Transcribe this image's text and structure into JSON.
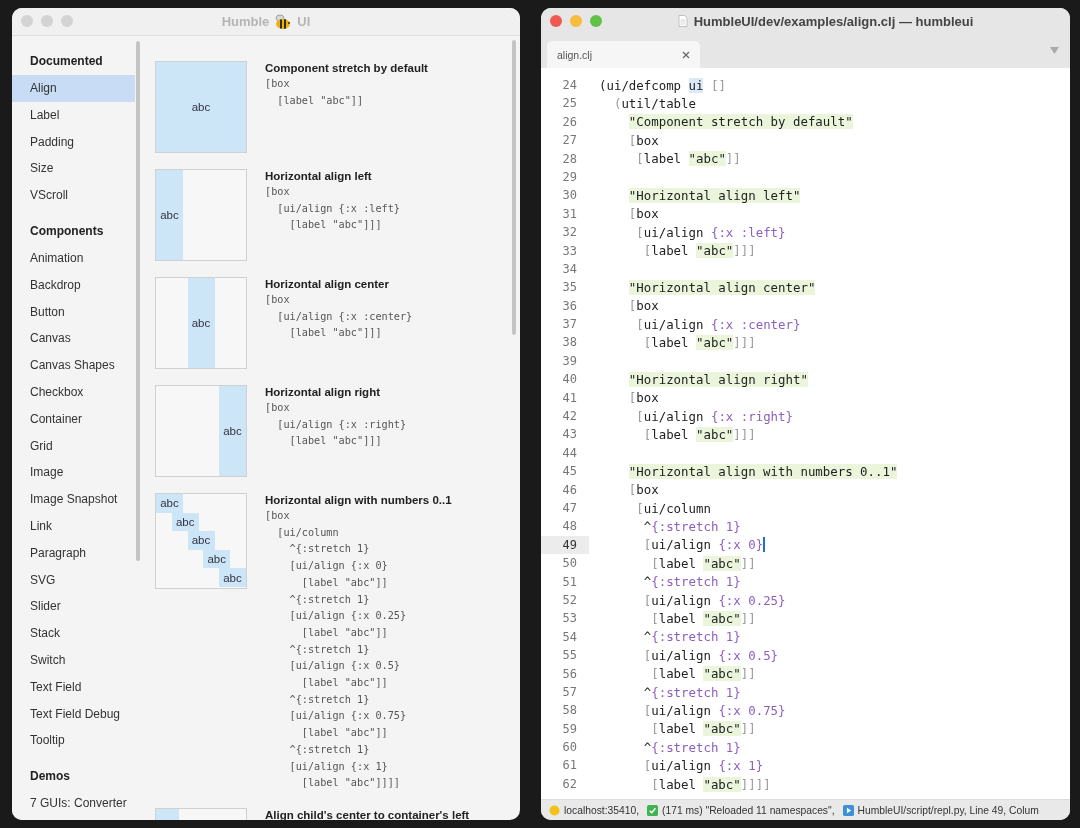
{
  "left_window": {
    "title_before_icon": "Humble",
    "title_after_icon": "UI",
    "sidebar": [
      {
        "heading": "Documented",
        "items": [
          {
            "label": "Align",
            "selected": true
          },
          {
            "label": "Label",
            "selected": false
          },
          {
            "label": "Padding",
            "selected": false
          },
          {
            "label": "Size",
            "selected": false
          },
          {
            "label": "VScroll",
            "selected": false
          }
        ]
      },
      {
        "heading": "Components",
        "items": [
          {
            "label": "Animation",
            "selected": false
          },
          {
            "label": "Backdrop",
            "selected": false
          },
          {
            "label": "Button",
            "selected": false
          },
          {
            "label": "Canvas",
            "selected": false
          },
          {
            "label": "Canvas Shapes",
            "selected": false
          },
          {
            "label": "Checkbox",
            "selected": false
          },
          {
            "label": "Container",
            "selected": false
          },
          {
            "label": "Grid",
            "selected": false
          },
          {
            "label": "Image",
            "selected": false
          },
          {
            "label": "Image Snapshot",
            "selected": false
          },
          {
            "label": "Link",
            "selected": false
          },
          {
            "label": "Paragraph",
            "selected": false
          },
          {
            "label": "SVG",
            "selected": false
          },
          {
            "label": "Slider",
            "selected": false
          },
          {
            "label": "Stack",
            "selected": false
          },
          {
            "label": "Switch",
            "selected": false
          },
          {
            "label": "Text Field",
            "selected": false
          },
          {
            "label": "Text Field Debug",
            "selected": false
          },
          {
            "label": "Tooltip",
            "selected": false
          }
        ]
      },
      {
        "heading": "Demos",
        "items": [
          {
            "label": "7 GUIs: Converter",
            "selected": false
          }
        ]
      }
    ],
    "examples": [
      {
        "title": "Component stretch by default",
        "code": [
          "[box",
          "  [label \"abc\"]]"
        ],
        "preview": {
          "kind": "stretch",
          "labels": [
            "abc"
          ]
        }
      },
      {
        "title": "Horizontal align left",
        "code": [
          "[box",
          "  [ui/align {:x :left}",
          "    [label \"abc\"]]]"
        ],
        "preview": {
          "kind": "left",
          "labels": [
            "abc"
          ]
        }
      },
      {
        "title": "Horizontal align center",
        "code": [
          "[box",
          "  [ui/align {:x :center}",
          "    [label \"abc\"]]]"
        ],
        "preview": {
          "kind": "center",
          "labels": [
            "abc"
          ]
        }
      },
      {
        "title": "Horizontal align right",
        "code": [
          "[box",
          "  [ui/align {:x :right}",
          "    [label \"abc\"]]]"
        ],
        "preview": {
          "kind": "right",
          "labels": [
            "abc"
          ]
        }
      },
      {
        "title": "Horizontal align with numbers 0..1",
        "code": [
          "[box",
          "  [ui/column",
          "    ^{:stretch 1}",
          "    [ui/align {:x 0}",
          "      [label \"abc\"]]",
          "    ^{:stretch 1}",
          "    [ui/align {:x 0.25}",
          "      [label \"abc\"]]",
          "    ^{:stretch 1}",
          "    [ui/align {:x 0.5}",
          "      [label \"abc\"]]",
          "    ^{:stretch 1}",
          "    [ui/align {:x 0.75}",
          "      [label \"abc\"]]",
          "    ^{:stretch 1}",
          "    [ui/align {:x 1}",
          "      [label \"abc\"]]]]"
        ],
        "preview": {
          "kind": "numbers",
          "labels": [
            "abc",
            "abc",
            "abc",
            "abc",
            "abc"
          ]
        }
      },
      {
        "title": "Align child's center to container's left",
        "preview": {
          "kind": "center-left"
        }
      }
    ]
  },
  "editor_window": {
    "title": "HumbleUI/dev/examples/align.clj — humbleui",
    "tabs": [
      {
        "label": "align.clj",
        "selected": true
      }
    ],
    "lines": [
      {
        "num": "24",
        "current": false,
        "segments": [
          {
            "kind": "plain",
            "text": "(ui/defcomp "
          },
          {
            "kind": "highlight",
            "text": "ui"
          },
          {
            "kind": "punct",
            "text": " []"
          }
        ]
      },
      {
        "num": "25",
        "current": false,
        "segments": [
          {
            "kind": "punct",
            "text": "  ("
          },
          {
            "kind": "plain",
            "text": "util/table"
          }
        ]
      },
      {
        "num": "26",
        "current": false,
        "segments": [
          {
            "kind": "string",
            "text": "    \"Component stretch by default\""
          }
        ]
      },
      {
        "num": "27",
        "current": false,
        "segments": [
          {
            "kind": "punct",
            "text": "    ["
          },
          {
            "kind": "plain",
            "text": "box"
          }
        ]
      },
      {
        "num": "28",
        "current": false,
        "segments": [
          {
            "kind": "punct",
            "text": "     ["
          },
          {
            "kind": "plain",
            "text": "label "
          },
          {
            "kind": "string",
            "text": "\"abc\""
          },
          {
            "kind": "punct",
            "text": "]]"
          }
        ]
      },
      {
        "num": "29",
        "current": false
      },
      {
        "num": "30",
        "current": false,
        "segments": [
          {
            "kind": "string",
            "text": "    \"Horizontal align left\""
          }
        ]
      },
      {
        "num": "31",
        "current": false,
        "segments": [
          {
            "kind": "punct",
            "text": "    ["
          },
          {
            "kind": "plain",
            "text": "box"
          }
        ]
      },
      {
        "num": "32",
        "current": false,
        "segments": [
          {
            "kind": "punct",
            "text": "     ["
          },
          {
            "kind": "plain",
            "text": "ui/align "
          },
          {
            "kind": "keyword",
            "text": "{:x :left}"
          }
        ]
      },
      {
        "num": "33",
        "current": false,
        "segments": [
          {
            "kind": "punct",
            "text": "      ["
          },
          {
            "kind": "plain",
            "text": "label "
          },
          {
            "kind": "string",
            "text": "\"abc\""
          },
          {
            "kind": "punct",
            "text": "]]]"
          }
        ]
      },
      {
        "num": "34",
        "current": false
      },
      {
        "num": "35",
        "current": false,
        "segments": [
          {
            "kind": "string",
            "text": "    \"Horizontal align center\""
          }
        ]
      },
      {
        "num": "36",
        "current": false,
        "segments": [
          {
            "kind": "punct",
            "text": "    ["
          },
          {
            "kind": "plain",
            "text": "box"
          }
        ]
      },
      {
        "num": "37",
        "current": false,
        "segments": [
          {
            "kind": "punct",
            "text": "     ["
          },
          {
            "kind": "plain",
            "text": "ui/align "
          },
          {
            "kind": "keyword",
            "text": "{:x :center}"
          }
        ]
      },
      {
        "num": "38",
        "current": false,
        "segments": [
          {
            "kind": "punct",
            "text": "      ["
          },
          {
            "kind": "plain",
            "text": "label "
          },
          {
            "kind": "string",
            "text": "\"abc\""
          },
          {
            "kind": "punct",
            "text": "]]]"
          }
        ]
      },
      {
        "num": "39",
        "current": false
      },
      {
        "num": "40",
        "current": false,
        "segments": [
          {
            "kind": "string",
            "text": "    \"Horizontal align right\""
          }
        ]
      },
      {
        "num": "41",
        "current": false,
        "segments": [
          {
            "kind": "punct",
            "text": "    ["
          },
          {
            "kind": "plain",
            "text": "box"
          }
        ]
      },
      {
        "num": "42",
        "current": false,
        "segments": [
          {
            "kind": "punct",
            "text": "     ["
          },
          {
            "kind": "plain",
            "text": "ui/align "
          },
          {
            "kind": "keyword",
            "text": "{:x :right}"
          }
        ]
      },
      {
        "num": "43",
        "current": false,
        "segments": [
          {
            "kind": "punct",
            "text": "      ["
          },
          {
            "kind": "plain",
            "text": "label "
          },
          {
            "kind": "string",
            "text": "\"abc\""
          },
          {
            "kind": "punct",
            "text": "]]]"
          }
        ]
      },
      {
        "num": "44",
        "current": false
      },
      {
        "num": "45",
        "current": false,
        "segments": [
          {
            "kind": "string",
            "text": "    \"Horizontal align with numbers 0..1\""
          }
        ]
      },
      {
        "num": "46",
        "current": false,
        "segments": [
          {
            "kind": "punct",
            "text": "    ["
          },
          {
            "kind": "plain",
            "text": "box"
          }
        ]
      },
      {
        "num": "47",
        "current": false,
        "segments": [
          {
            "kind": "punct",
            "text": "     ["
          },
          {
            "kind": "plain",
            "text": "ui/column"
          }
        ]
      },
      {
        "num": "48",
        "current": false,
        "segments": [
          {
            "kind": "plain",
            "text": "      ^"
          },
          {
            "kind": "keyword",
            "text": "{:stretch 1}"
          }
        ]
      },
      {
        "num": "49",
        "current": true,
        "segments": [
          {
            "kind": "punct",
            "text": "      ["
          },
          {
            "kind": "plain",
            "text": "ui/align "
          },
          {
            "kind": "keyword",
            "text": "{:x 0}"
          }
        ]
      },
      {
        "num": "50",
        "current": false,
        "segments": [
          {
            "kind": "punct",
            "text": "       ["
          },
          {
            "kind": "plain",
            "text": "label "
          },
          {
            "kind": "string",
            "text": "\"abc\""
          },
          {
            "kind": "punct",
            "text": "]]"
          }
        ]
      },
      {
        "num": "51",
        "current": false,
        "segments": [
          {
            "kind": "plain",
            "text": "      ^"
          },
          {
            "kind": "keyword",
            "text": "{:stretch 1}"
          }
        ]
      },
      {
        "num": "52",
        "current": false,
        "segments": [
          {
            "kind": "punct",
            "text": "      ["
          },
          {
            "kind": "plain",
            "text": "ui/align "
          },
          {
            "kind": "keyword",
            "text": "{:x 0.25}"
          }
        ]
      },
      {
        "num": "53",
        "current": false,
        "segments": [
          {
            "kind": "punct",
            "text": "       ["
          },
          {
            "kind": "plain",
            "text": "label "
          },
          {
            "kind": "string",
            "text": "\"abc\""
          },
          {
            "kind": "punct",
            "text": "]]"
          }
        ]
      },
      {
        "num": "54",
        "current": false,
        "segments": [
          {
            "kind": "plain",
            "text": "      ^"
          },
          {
            "kind": "keyword",
            "text": "{:stretch 1}"
          }
        ]
      },
      {
        "num": "55",
        "current": false,
        "segments": [
          {
            "kind": "punct",
            "text": "      ["
          },
          {
            "kind": "plain",
            "text": "ui/align "
          },
          {
            "kind": "keyword",
            "text": "{:x 0.5}"
          }
        ]
      },
      {
        "num": "56",
        "current": false,
        "segments": [
          {
            "kind": "punct",
            "text": "       ["
          },
          {
            "kind": "plain",
            "text": "label "
          },
          {
            "kind": "string",
            "text": "\"abc\""
          },
          {
            "kind": "punct",
            "text": "]]"
          }
        ]
      },
      {
        "num": "57",
        "current": false,
        "segments": [
          {
            "kind": "plain",
            "text": "      ^"
          },
          {
            "kind": "keyword",
            "text": "{:stretch 1}"
          }
        ]
      },
      {
        "num": "58",
        "current": false,
        "segments": [
          {
            "kind": "punct",
            "text": "      ["
          },
          {
            "kind": "plain",
            "text": "ui/align "
          },
          {
            "kind": "keyword",
            "text": "{:x 0.75}"
          }
        ]
      },
      {
        "num": "59",
        "current": false,
        "segments": [
          {
            "kind": "punct",
            "text": "       ["
          },
          {
            "kind": "plain",
            "text": "label "
          },
          {
            "kind": "string",
            "text": "\"abc\""
          },
          {
            "kind": "punct",
            "text": "]]"
          }
        ]
      },
      {
        "num": "60",
        "current": false,
        "segments": [
          {
            "kind": "plain",
            "text": "      ^"
          },
          {
            "kind": "keyword",
            "text": "{:stretch 1}"
          }
        ]
      },
      {
        "num": "61",
        "current": false,
        "segments": [
          {
            "kind": "punct",
            "text": "      ["
          },
          {
            "kind": "plain",
            "text": "ui/align "
          },
          {
            "kind": "keyword",
            "text": "{:x 1}"
          }
        ]
      },
      {
        "num": "62",
        "current": false,
        "segments": [
          {
            "kind": "punct",
            "text": "       ["
          },
          {
            "kind": "plain",
            "text": "label "
          },
          {
            "kind": "string",
            "text": "\"abc\""
          },
          {
            "kind": "punct",
            "text": "]]]]"
          }
        ]
      }
    ],
    "status": [
      {
        "kind": "server",
        "text": "localhost:35410,"
      },
      {
        "kind": "result",
        "text": "(171 ms) \"Reloaded 11 namespaces\","
      },
      {
        "kind": "script",
        "text": "HumbleUI/script/repl.py, Line 49, Colum"
      }
    ]
  }
}
